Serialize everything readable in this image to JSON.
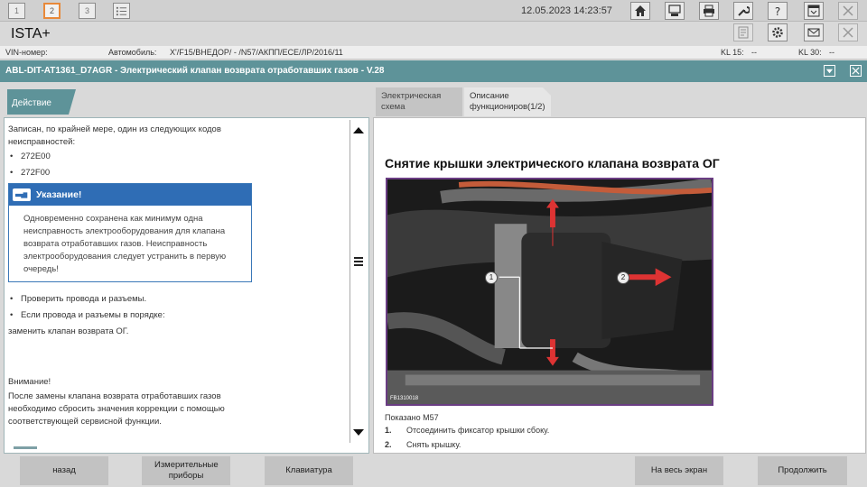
{
  "toolbar": {
    "tabs": [
      "1",
      "2",
      "3"
    ],
    "active_tab": "2",
    "datetime": "12.05.2023 14:23:57",
    "icons": [
      "list-icon",
      "home-icon",
      "vehicle-icon",
      "print-icon",
      "wrench-icon",
      "help-icon",
      "display-icon",
      "close-icon"
    ]
  },
  "app": {
    "title": "ISTA+",
    "row_icons": [
      "notes-icon",
      "settings-icon",
      "mail-icon",
      "close-icon"
    ]
  },
  "vehicle": {
    "vin_label": "VIN-номер:",
    "vin_value": "",
    "car_label": "Автомобиль:",
    "car_value": "X'/F15/ВНЕДОР/ - /N57/АКПП/ЕСЕ/ЛР/2016/11",
    "kl15_label": "KL 15:",
    "kl15_value": "--",
    "kl30_label": "KL 30:",
    "kl30_value": "--"
  },
  "header": {
    "title": "ABL-DIT-AT1361_D7AGR - Электрический клапан возврата отработавших газов - V.28"
  },
  "left": {
    "tab": "Действие",
    "intro": "Записан, по крайней мере, один из следующих кодов неисправностей:",
    "codes": [
      "272E00",
      "272F00"
    ],
    "note_title": "Указание!",
    "note_text": "Одновременно сохранена как минимум одна неисправность электрооборудования для клапана возврата отработавших газов. Неисправность электрооборудования следует устранить в первую очередь!",
    "checks": [
      "Проверить провода и разъемы.",
      "Если провода и разъемы в порядке:"
    ],
    "action": "заменить клапан возврата ОГ.",
    "attention_title": "Внимание!",
    "attention_text": "После замены клапана возврата отработавших газов необходимо сбросить значения коррекции с помощью соответствующей сервисной функции."
  },
  "right": {
    "tabs": [
      {
        "label": "Электрическая схема",
        "active": false
      },
      {
        "label": "Описание функциониров(1/2)",
        "active": true
      }
    ],
    "title": "Снятие крышки электрического клапана возврата ОГ",
    "image_code": "FB1310018",
    "callouts": [
      "1",
      "2"
    ],
    "caption": "Показано M57",
    "steps": [
      {
        "num": "1.",
        "text": "Отсоединить фиксатор крышки сбоку."
      },
      {
        "num": "2.",
        "text": "Снять крышку."
      }
    ]
  },
  "buttons": {
    "back": "назад",
    "meters": "Измерительные приборы",
    "keyboard": "Клавиатура",
    "fullscreen": "На весь экран",
    "continue": "Продолжить"
  }
}
